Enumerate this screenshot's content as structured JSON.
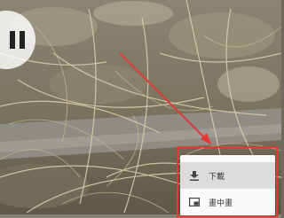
{
  "player": {
    "pause_icon": "pause-icon"
  },
  "context_menu": {
    "items": [
      {
        "label": "下載",
        "icon": "download-icon",
        "hovered": true
      },
      {
        "label": "畫中畫",
        "icon": "picture-in-picture-icon",
        "hovered": false
      }
    ]
  },
  "annotation": {
    "color": "#e53935"
  }
}
